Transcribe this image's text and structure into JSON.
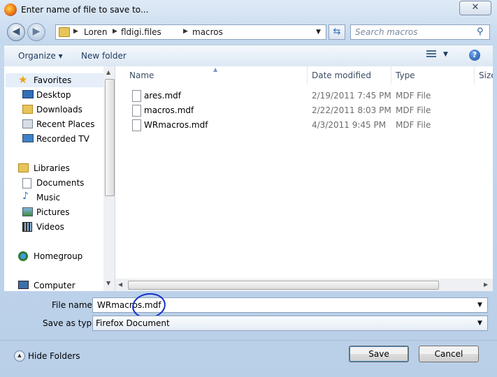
{
  "window": {
    "title": "Enter name of file to save to...",
    "close_glyph": "✕"
  },
  "nav": {
    "back_glyph": "◀",
    "forward_glyph": "▶",
    "breadcrumb": [
      "Loren",
      "fldigi.files",
      "macros"
    ],
    "search_placeholder": "Search macros"
  },
  "toolbar": {
    "organize_label": "Organize ▾",
    "new_folder_label": "New folder",
    "help_glyph": "?"
  },
  "sidebar": {
    "favorites": {
      "label": "Favorites",
      "items": [
        "Desktop",
        "Downloads",
        "Recent Places",
        "Recorded TV"
      ]
    },
    "libraries": {
      "label": "Libraries",
      "items": [
        "Documents",
        "Music",
        "Pictures",
        "Videos"
      ]
    },
    "homegroup": {
      "label": "Homegroup"
    },
    "computer": {
      "label": "Computer"
    }
  },
  "columns": {
    "name": "Name",
    "date": "Date modified",
    "type": "Type",
    "size": "Size"
  },
  "files": [
    {
      "name": "ares.mdf",
      "date": "2/19/2011 7:45 PM",
      "type": "MDF File"
    },
    {
      "name": "macros.mdf",
      "date": "2/22/2011 8:03 PM",
      "type": "MDF File"
    },
    {
      "name": "WRmacros.mdf",
      "date": "4/3/2011 9:45 PM",
      "type": "MDF File"
    }
  ],
  "form": {
    "file_name_label": "File name:",
    "file_name_value": "WRmacros.mdf",
    "save_type_label": "Save as type:",
    "save_type_value": "Firefox Document"
  },
  "footer": {
    "hide_folders_label": "Hide Folders",
    "save_label": "Save",
    "cancel_label": "Cancel"
  },
  "colors": {
    "accent": "#1432c8",
    "folder": "#e8c45a",
    "frame": "#c4d8ee"
  }
}
